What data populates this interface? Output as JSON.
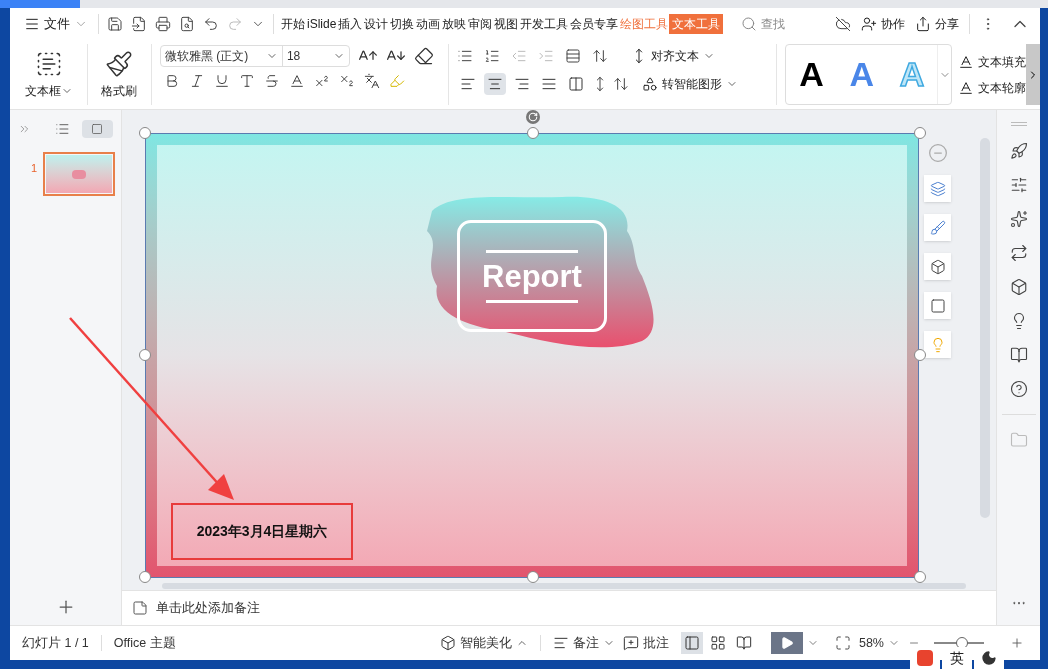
{
  "menu": {
    "label": "文件"
  },
  "ribbon_tabs": [
    {
      "label": "开始",
      "selected": false,
      "kind": "normal"
    },
    {
      "label": "iSlide",
      "selected": false,
      "kind": "normal"
    },
    {
      "label": "插入",
      "selected": false,
      "kind": "normal"
    },
    {
      "label": "设计",
      "selected": false,
      "kind": "normal"
    },
    {
      "label": "切换",
      "selected": false,
      "kind": "normal"
    },
    {
      "label": "动画",
      "selected": false,
      "kind": "normal"
    },
    {
      "label": "放映",
      "selected": false,
      "kind": "normal"
    },
    {
      "label": "审阅",
      "selected": false,
      "kind": "normal"
    },
    {
      "label": "视图",
      "selected": false,
      "kind": "normal"
    },
    {
      "label": "开发工具",
      "selected": false,
      "kind": "normal"
    },
    {
      "label": "会员专享",
      "selected": false,
      "kind": "normal"
    },
    {
      "label": "绘图工具",
      "selected": false,
      "kind": "context"
    },
    {
      "label": "文本工具",
      "selected": true,
      "kind": "context"
    }
  ],
  "search": {
    "label": "查找"
  },
  "actions": [
    {
      "label": "协作",
      "kind": "collab"
    },
    {
      "label": "分享",
      "kind": "share"
    }
  ],
  "ribbon": {
    "textbox": "文本框",
    "format_painter": "格式刷",
    "font": "微软雅黑 (正文)",
    "size": "18",
    "align_text": "对齐文本",
    "smart_shape": "转智能图形",
    "fill": "文本填充",
    "outline": "文本轮廓",
    "alignments": [
      {
        "kind": "left",
        "selected": false
      },
      {
        "kind": "center",
        "selected": true
      },
      {
        "kind": "right",
        "selected": false
      },
      {
        "kind": "justify",
        "selected": false
      },
      {
        "kind": "distribute",
        "selected": false
      }
    ],
    "styles": [
      {
        "label": "A",
        "kind": "solid"
      },
      {
        "label": "A",
        "kind": "blue"
      },
      {
        "label": "A",
        "kind": "outline"
      }
    ]
  },
  "slides": [
    {
      "number": "1",
      "selected": true
    }
  ],
  "slide": {
    "title": "Report",
    "date": "2023年3月4日星期六"
  },
  "notes": {
    "placeholder": "单击此处添加备注"
  },
  "status": {
    "slide_count": "幻灯片 1 / 1",
    "theme": "Office 主题",
    "beautify": "智能美化",
    "notes": "备注",
    "comments": "批注",
    "zoom": "58%",
    "zoom_level": {
      "level": 0.55
    },
    "views": [
      {
        "kind": "normal",
        "selected": true
      },
      {
        "kind": "sorter",
        "selected": false
      },
      {
        "kind": "reading",
        "selected": false
      }
    ]
  },
  "ime": {
    "label": "英"
  }
}
